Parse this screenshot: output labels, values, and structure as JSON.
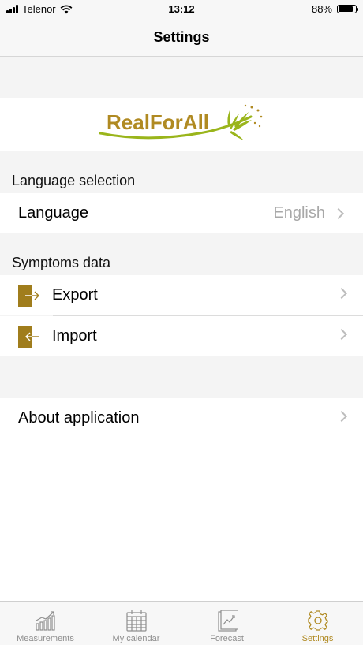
{
  "status_bar": {
    "carrier": "Telenor",
    "time": "13:12",
    "battery_percent": "88%",
    "battery_level": 0.88
  },
  "nav": {
    "title": "Settings"
  },
  "logo": {
    "text": "RealForAll"
  },
  "language_section": {
    "header": "Language selection",
    "row_label": "Language",
    "row_value": "English"
  },
  "symptoms_section": {
    "header": "Symptoms data",
    "export_label": "Export",
    "import_label": "Import"
  },
  "about": {
    "label": "About application"
  },
  "tabs": [
    {
      "label": "Measurements",
      "icon": "bar-chart-icon",
      "active": false
    },
    {
      "label": "My calendar",
      "icon": "calendar-icon",
      "active": false
    },
    {
      "label": "Forecast",
      "icon": "forecast-icon",
      "active": false
    },
    {
      "label": "Settings",
      "icon": "gear-icon",
      "active": true
    }
  ],
  "colors": {
    "accent": "#b08a22",
    "logo_green": "#9ab51b",
    "logo_gold": "#b08a22"
  }
}
